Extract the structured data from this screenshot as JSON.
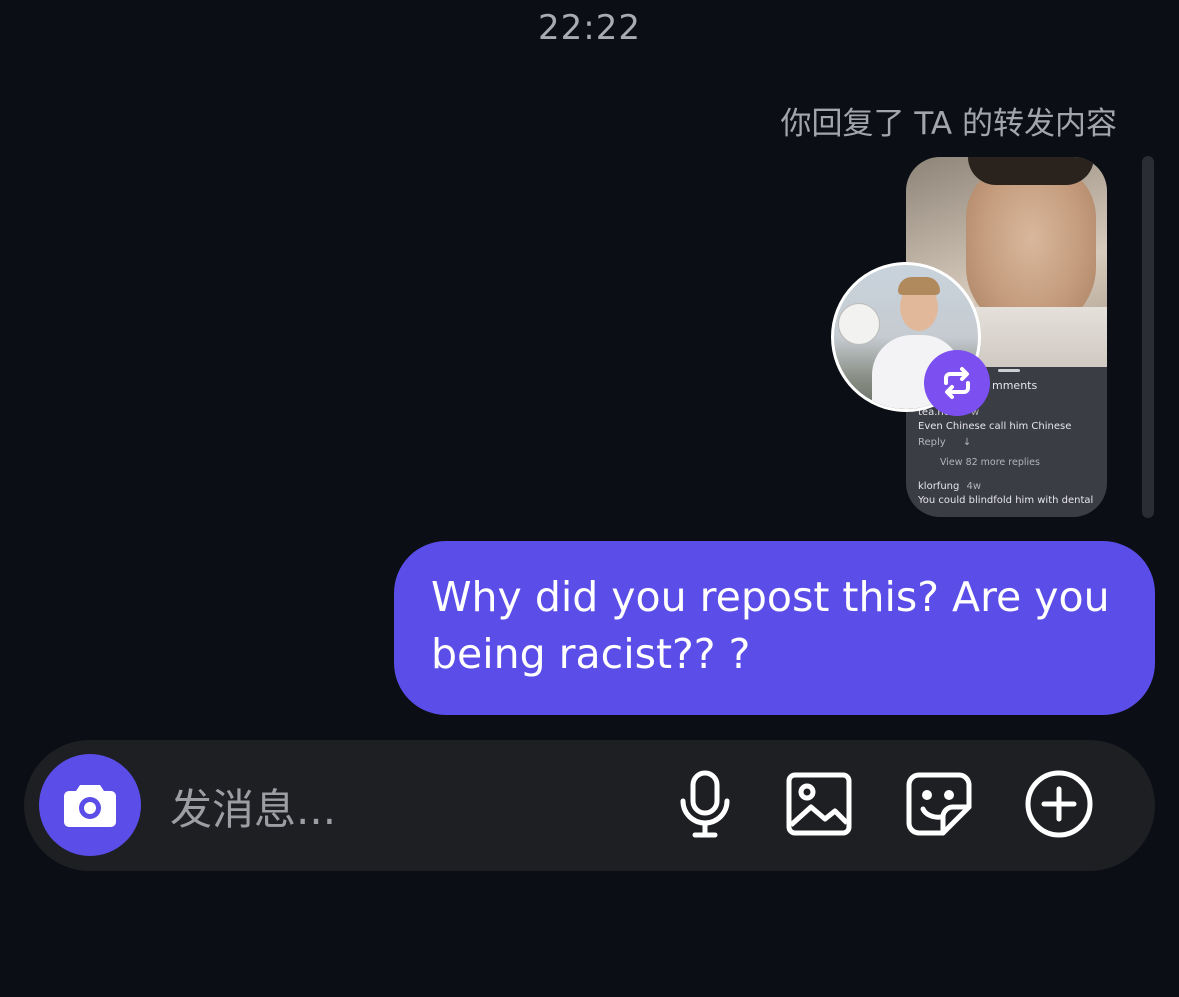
{
  "header": {
    "time": "22:22"
  },
  "thread": {
    "reply_note": "你回复了 TA 的转发内容",
    "repost_card": {
      "comments_label": "mments",
      "comment_1": {
        "user": "tea.no",
        "age": "w",
        "text": "Even Chinese call him Chinese",
        "reply_label": "Reply",
        "more_replies": "View 82 more replies"
      },
      "comment_2": {
        "user": "klorfung",
        "age": "4w",
        "text": "You could blindfold him with dental"
      }
    },
    "message": {
      "text": "Why did you repost this? Are you being racist?? ?",
      "bubble_color": "#5b4de8"
    }
  },
  "composer": {
    "placeholder": "发消息...",
    "icons": [
      "camera-icon",
      "microphone-icon",
      "image-icon",
      "sticker-icon",
      "plus-icon"
    ]
  },
  "colors": {
    "background": "#0b0e14",
    "accent": "#5b4de8",
    "repost": "#7b4ff0"
  }
}
